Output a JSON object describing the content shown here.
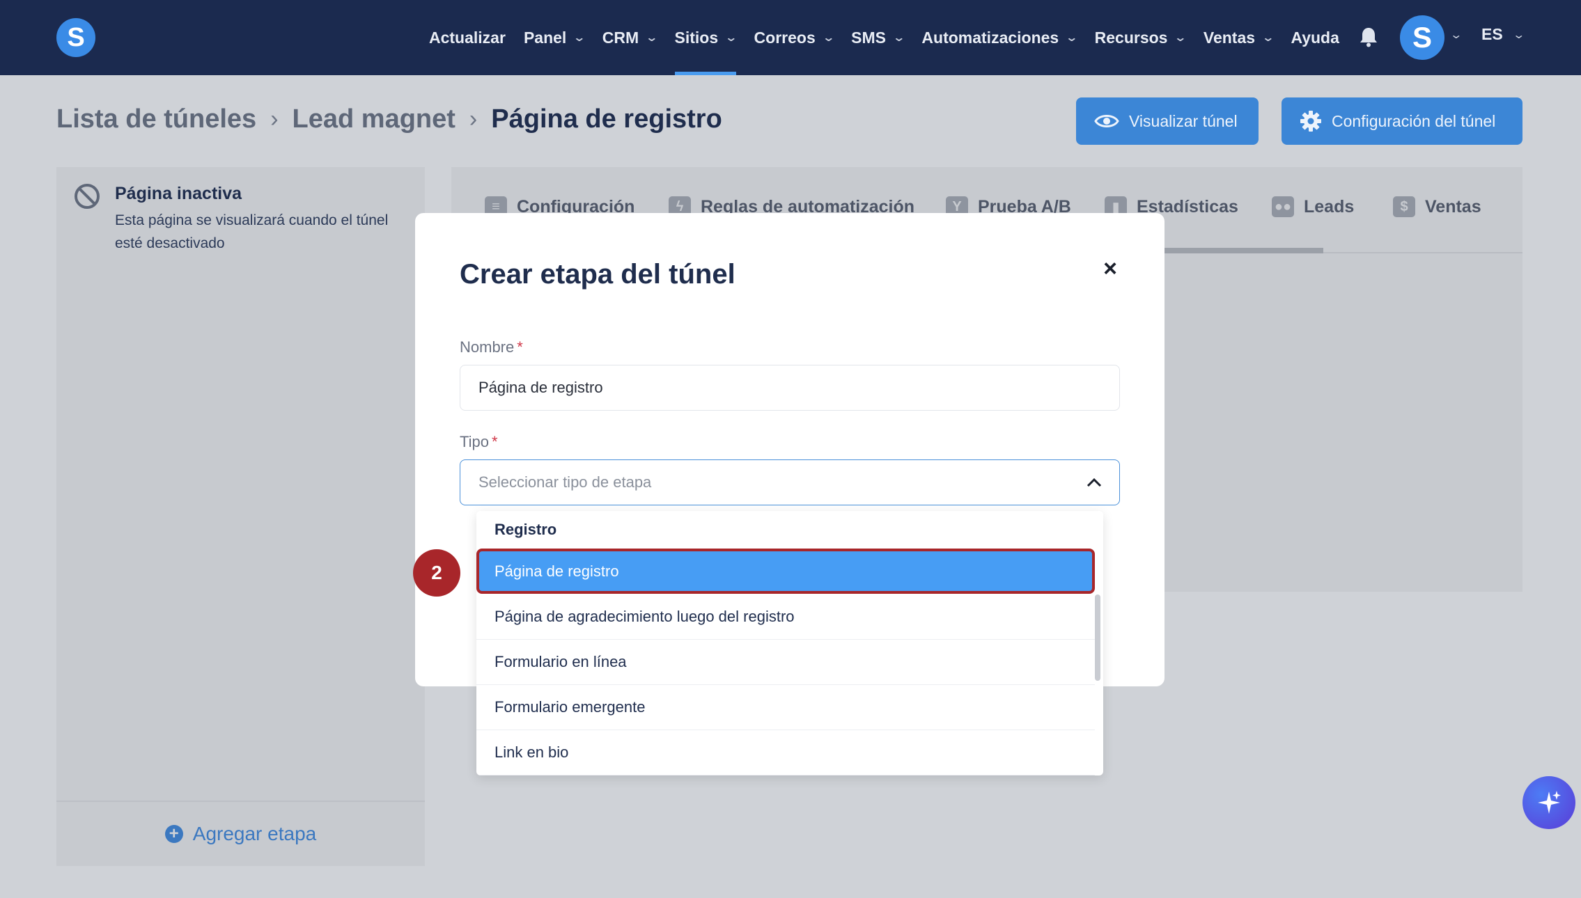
{
  "nav": {
    "logo_letter": "S",
    "items": [
      {
        "label": "Actualizar",
        "chevron": false,
        "active": false
      },
      {
        "label": "Panel",
        "chevron": true,
        "active": false
      },
      {
        "label": "CRM",
        "chevron": true,
        "active": false
      },
      {
        "label": "Sitios",
        "chevron": true,
        "active": true
      },
      {
        "label": "Correos",
        "chevron": true,
        "active": false
      },
      {
        "label": "SMS",
        "chevron": true,
        "active": false
      },
      {
        "label": "Automatizaciones",
        "chevron": true,
        "active": false
      },
      {
        "label": "Recursos",
        "chevron": true,
        "active": false
      },
      {
        "label": "Ventas",
        "chevron": true,
        "active": false
      },
      {
        "label": "Ayuda",
        "chevron": false,
        "active": false
      }
    ],
    "avatar_letter": "S",
    "language": "ES"
  },
  "breadcrumb": {
    "items": [
      "Lista de túneles",
      "Lead magnet",
      "Página de registro"
    ]
  },
  "actions": {
    "view_label": "Visualizar túnel",
    "config_label": "Configuración del túnel"
  },
  "left_panel": {
    "title": "Página inactiva",
    "description": "Esta página se visualizará cuando el túnel esté desactivado",
    "add_stage_label": "Agregar etapa"
  },
  "tabs": [
    {
      "label": "Configuración"
    },
    {
      "label": "Reglas de automatización"
    },
    {
      "label": "Prueba A/B"
    },
    {
      "label": "Estadísticas"
    },
    {
      "label": "Leads"
    },
    {
      "label": "Ventas"
    }
  ],
  "modal": {
    "title": "Crear etapa del túnel",
    "name_label": "Nombre",
    "name_value": "Página de registro",
    "type_label": "Tipo",
    "type_placeholder": "Seleccionar tipo de etapa"
  },
  "dropdown": {
    "group": "Registro",
    "options": [
      "Página de registro",
      "Página de agradecimiento luego del registro",
      "Formulario en línea",
      "Formulario emergente",
      "Link en bio"
    ],
    "selected_index": 0
  },
  "step_badge": "2",
  "colors": {
    "topbar": "#1b2a4f",
    "accent": "#3c86d6",
    "selected_option": "#479df4",
    "highlight_border": "#a8262a"
  }
}
